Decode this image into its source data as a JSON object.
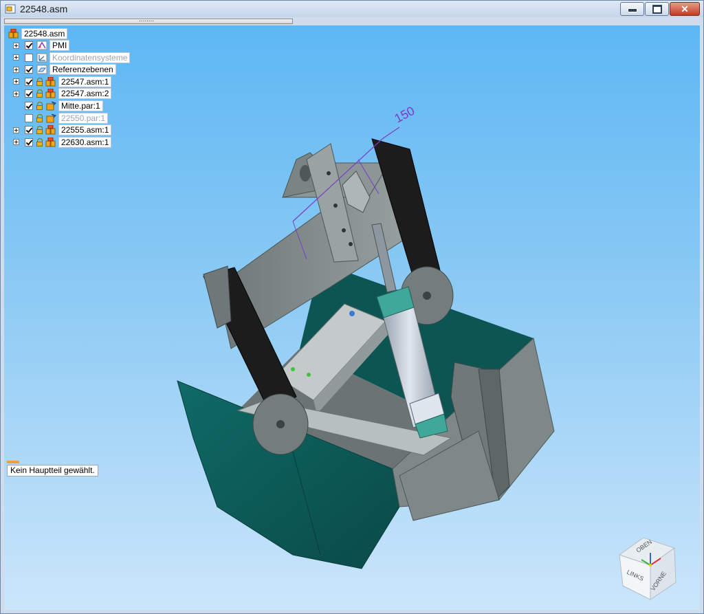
{
  "window": {
    "title": "22548.asm"
  },
  "tree": {
    "root": {
      "label": "22548.asm"
    },
    "items": [
      {
        "label": "PMI",
        "checked": true,
        "expandable": true,
        "dim": false,
        "icon": "pmi-icon"
      },
      {
        "label": "Koordinatensysteme",
        "checked": false,
        "expandable": true,
        "dim": true,
        "icon": "coordinate-system-icon"
      },
      {
        "label": "Referenzebenen",
        "checked": true,
        "expandable": true,
        "dim": false,
        "icon": "reference-plane-icon"
      },
      {
        "label": "22547.asm:1",
        "checked": true,
        "expandable": true,
        "dim": false,
        "icon": "assembly-icon"
      },
      {
        "label": "22547.asm:2",
        "checked": true,
        "expandable": true,
        "dim": false,
        "icon": "assembly-icon"
      },
      {
        "label": "Mitte.par:1",
        "checked": true,
        "expandable": false,
        "dim": false,
        "icon": "part-icon"
      },
      {
        "label": "22550.par:1",
        "checked": false,
        "expandable": false,
        "dim": true,
        "icon": "part-icon"
      },
      {
        "label": "22555.asm:1",
        "checked": true,
        "expandable": true,
        "dim": false,
        "icon": "assembly-icon"
      },
      {
        "label": "22630.asm:1",
        "checked": true,
        "expandable": true,
        "dim": false,
        "icon": "assembly-icon"
      }
    ]
  },
  "status": {
    "message": "Kein Hauptteil gewählt."
  },
  "dimension": {
    "value": "150"
  },
  "viewcube": {
    "top": "OBEN",
    "left": "LINKS",
    "front": "VORNE"
  },
  "colors": {
    "bucket": "#0f5a57",
    "steel": "#7b8484",
    "cylinder": "#3fa89a",
    "dimension": "#7a3cc8"
  }
}
